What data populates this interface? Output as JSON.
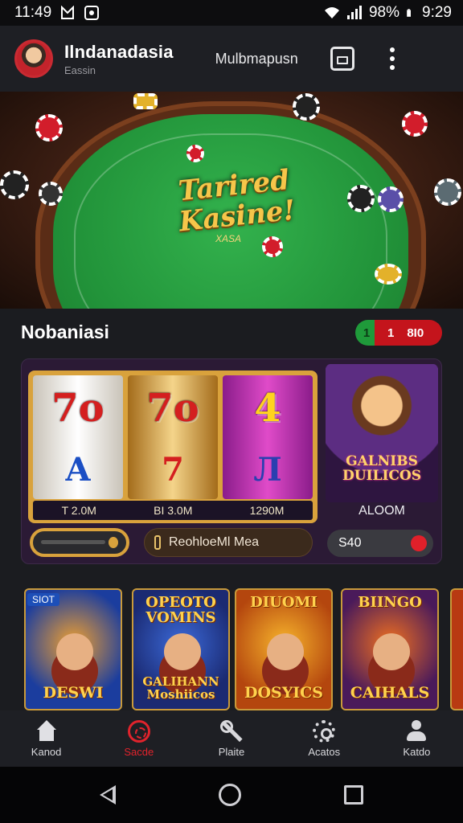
{
  "status": {
    "time_left": "11:49",
    "battery": "98%",
    "time_right": "9:29"
  },
  "header": {
    "title": "Ilndanadasia",
    "subtitle": "Eassin",
    "link": "Mulbmapusn",
    "icons": [
      "save-icon",
      "more-vert-icon"
    ]
  },
  "hero": {
    "title": "Tarired Kasine!",
    "subtitle": "XASA"
  },
  "section": {
    "title": "Nobaniasi",
    "pill_badge": "1",
    "pill_count": "1",
    "pill_text": "8I0"
  },
  "feature": {
    "reels": [
      {
        "top": "7o",
        "bottom": "A"
      },
      {
        "top": "7o",
        "bottom": "7"
      },
      {
        "top": "4",
        "bottom": "Л"
      }
    ],
    "stats": [
      "T 2.0M",
      "BI 3.0M",
      "1290M"
    ],
    "redeem_label": "ReohloeMl Mea",
    "promo_text": "GALNIBS DUILICOS",
    "promo_label": "ALOOM",
    "promo_value": "S40"
  },
  "tiles": [
    {
      "badge": "SIOT",
      "top": "",
      "bottom": "DESWI"
    },
    {
      "badge": "",
      "top": "OPEOTO VOMINS",
      "bottom": "GALIHANN Moshiicos"
    },
    {
      "badge": "",
      "top": "DIUOMI",
      "bottom": "DOSYICS"
    },
    {
      "badge": "",
      "top": "BIINGO",
      "bottom": "CAIHALS"
    }
  ],
  "nav": [
    {
      "label": "Kanod",
      "icon": "home-icon",
      "active": false
    },
    {
      "label": "Sacde",
      "icon": "casino-chip-icon",
      "active": true
    },
    {
      "label": "Plaite",
      "icon": "tools-icon",
      "active": false
    },
    {
      "label": "Acatos",
      "icon": "gear-icon",
      "active": false
    },
    {
      "label": "Katdo",
      "icon": "user-icon",
      "active": false
    }
  ],
  "colors": {
    "accent_red": "#e0232c",
    "felt_green": "#22943a",
    "gold": "#d9a23c",
    "background": "#1b1c20"
  }
}
